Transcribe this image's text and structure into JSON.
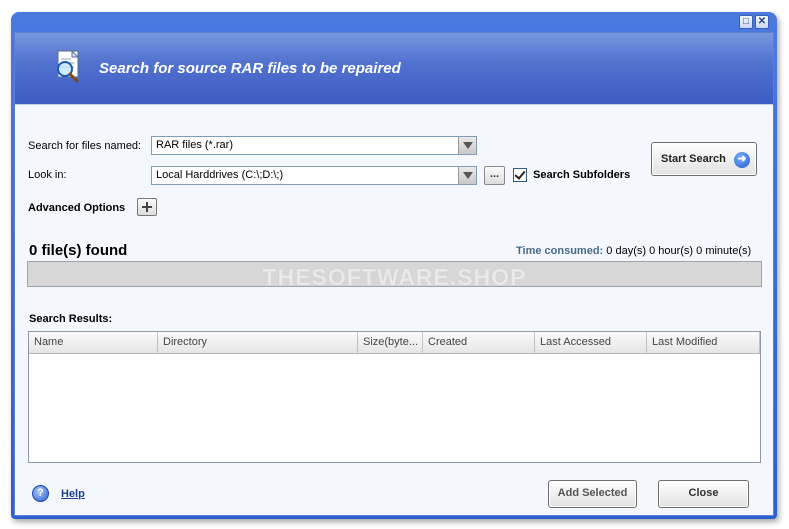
{
  "window": {
    "maximize_glyph": "□",
    "close_glyph": "✕"
  },
  "header": {
    "title": "Search for source RAR files to be repaired",
    "icon": "document-search-icon"
  },
  "search_form": {
    "files_named_label": "Search for files named:",
    "files_named_value": "RAR files (*.rar)",
    "look_in_label": "Look in:",
    "look_in_value": "Local Harddrives (C:\\;D:\\;)",
    "browse_label": "...",
    "subfolders_label": "Search Subfolders",
    "subfolders_checked": true,
    "advanced_label": "Advanced Options"
  },
  "start_search": {
    "label": "Start Search",
    "icon": "arrow-right-circle-icon"
  },
  "status": {
    "found_text": "0 file(s) found",
    "time_label": "Time consumed:",
    "time_value": "0 day(s) 0 hour(s) 0 minute(s)"
  },
  "watermark": "THESOFTWARE.SHOP",
  "results": {
    "label": "Search Results:",
    "columns": [
      "Name",
      "Directory",
      "Size(byte...",
      "Created",
      "Last Accessed",
      "Last Modified"
    ],
    "rows": []
  },
  "footer": {
    "help_label": "Help",
    "add_selected_label": "Add Selected",
    "close_label": "Close"
  },
  "colors": {
    "window_frame": "#2c5fcf",
    "header_gradient_top": "#7898df",
    "header_gradient_bottom": "#3c5cc4",
    "client_background": "#f4f8fe",
    "time_label_color": "#4a6b88"
  }
}
